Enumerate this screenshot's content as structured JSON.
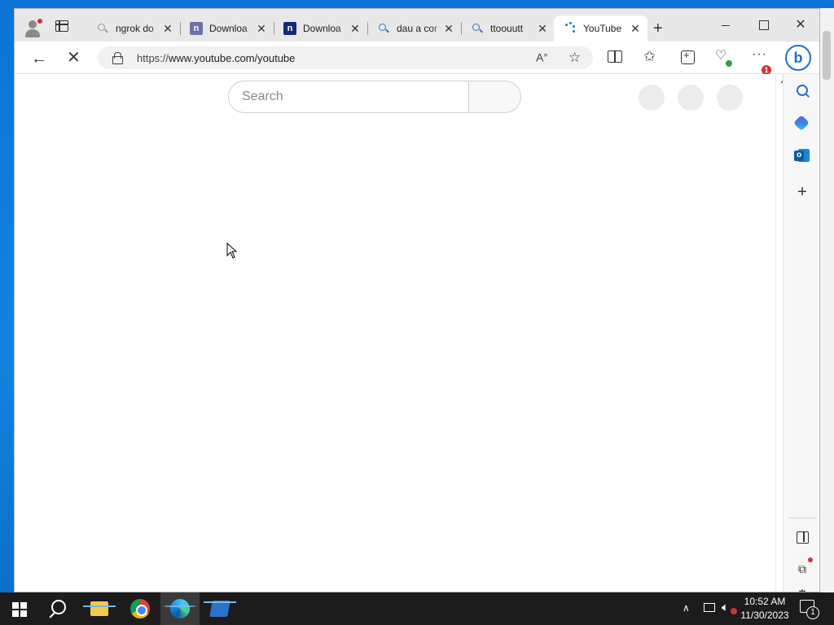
{
  "browser": {
    "tabs": [
      {
        "title": "ngrok do",
        "icon": "search-icon-gray"
      },
      {
        "title": "Downloa",
        "icon": "n-logo-icon"
      },
      {
        "title": "Downloa",
        "icon": "n-logo-icon"
      },
      {
        "title": "dau a cor",
        "icon": "search-icon"
      },
      {
        "title": "ttoouutt",
        "icon": "search-icon"
      },
      {
        "title": "YouTube",
        "icon": "loading-icon",
        "active": true
      }
    ],
    "tab_close_glyph": "✕",
    "new_tab_glyph": "+",
    "address": {
      "url_prefix": "https://",
      "url_main": "www.youtube.com/youtube"
    },
    "more_badge": "1",
    "bing_label": "b"
  },
  "page": {
    "search_placeholder": "Search"
  },
  "taskbar": {
    "time": "10:52 AM",
    "date": "11/30/2023",
    "notification_count": "1",
    "apps": [
      "file-explorer-icon",
      "chrome-icon",
      "edge-icon",
      "powershell-icon"
    ],
    "active_app": "edge-icon"
  }
}
